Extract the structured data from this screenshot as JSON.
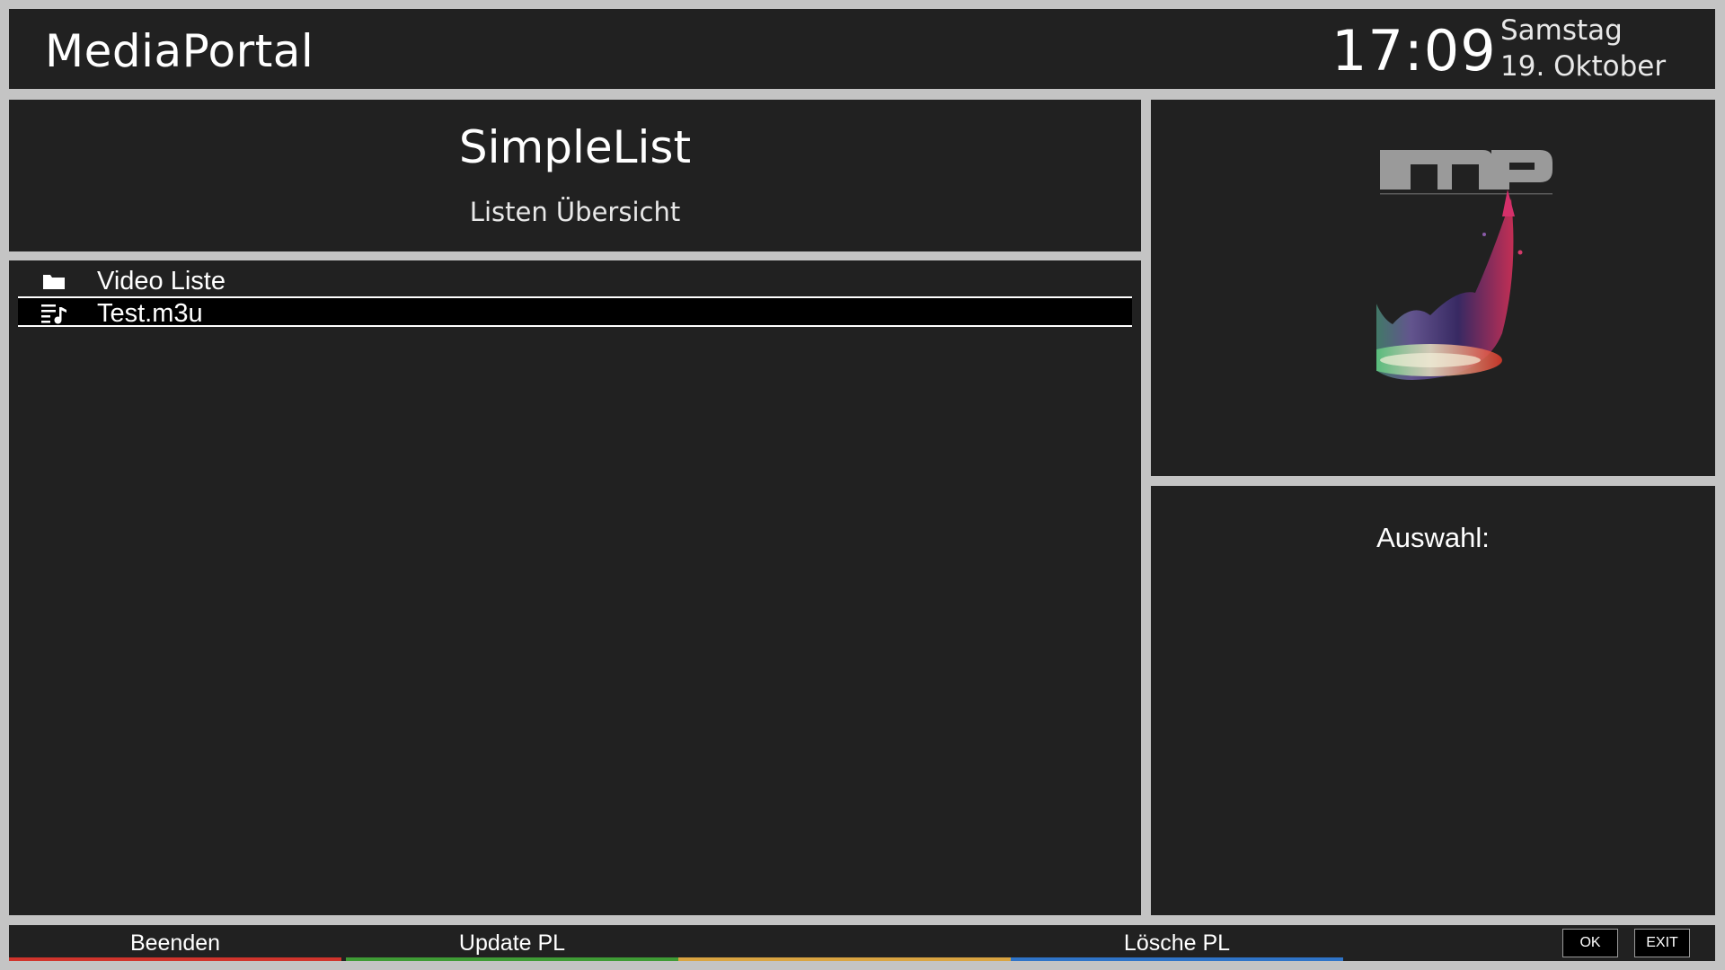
{
  "header": {
    "app_title": "MediaPortal",
    "clock": "17:09",
    "weekday": "Samstag",
    "date": "19. Oktober"
  },
  "title_panel": {
    "title": "SimpleList",
    "subtitle": "Listen Übersicht"
  },
  "list": {
    "items": [
      {
        "label": "Video Liste",
        "icon": "folder-icon",
        "selected": false
      },
      {
        "label": "Test.m3u",
        "icon": "playlist-music-icon",
        "selected": true
      }
    ]
  },
  "logo_panel": {
    "logo_text": "mP"
  },
  "selection_panel": {
    "label": "Auswahl:"
  },
  "footer": {
    "buttons": [
      {
        "label": "Beenden",
        "color": "#d0342c"
      },
      {
        "label": "Update PL",
        "color": "#3f9b35"
      },
      {
        "label": "",
        "color": "#d9a441"
      },
      {
        "label": "Lösche PL",
        "color": "#2f74c8"
      }
    ],
    "keys": {
      "ok": "OK",
      "exit": "EXIT"
    }
  },
  "colors": {
    "background": "#c4c4c4",
    "panel": "#212121",
    "selection": "#000000",
    "text": "#ffffff"
  }
}
